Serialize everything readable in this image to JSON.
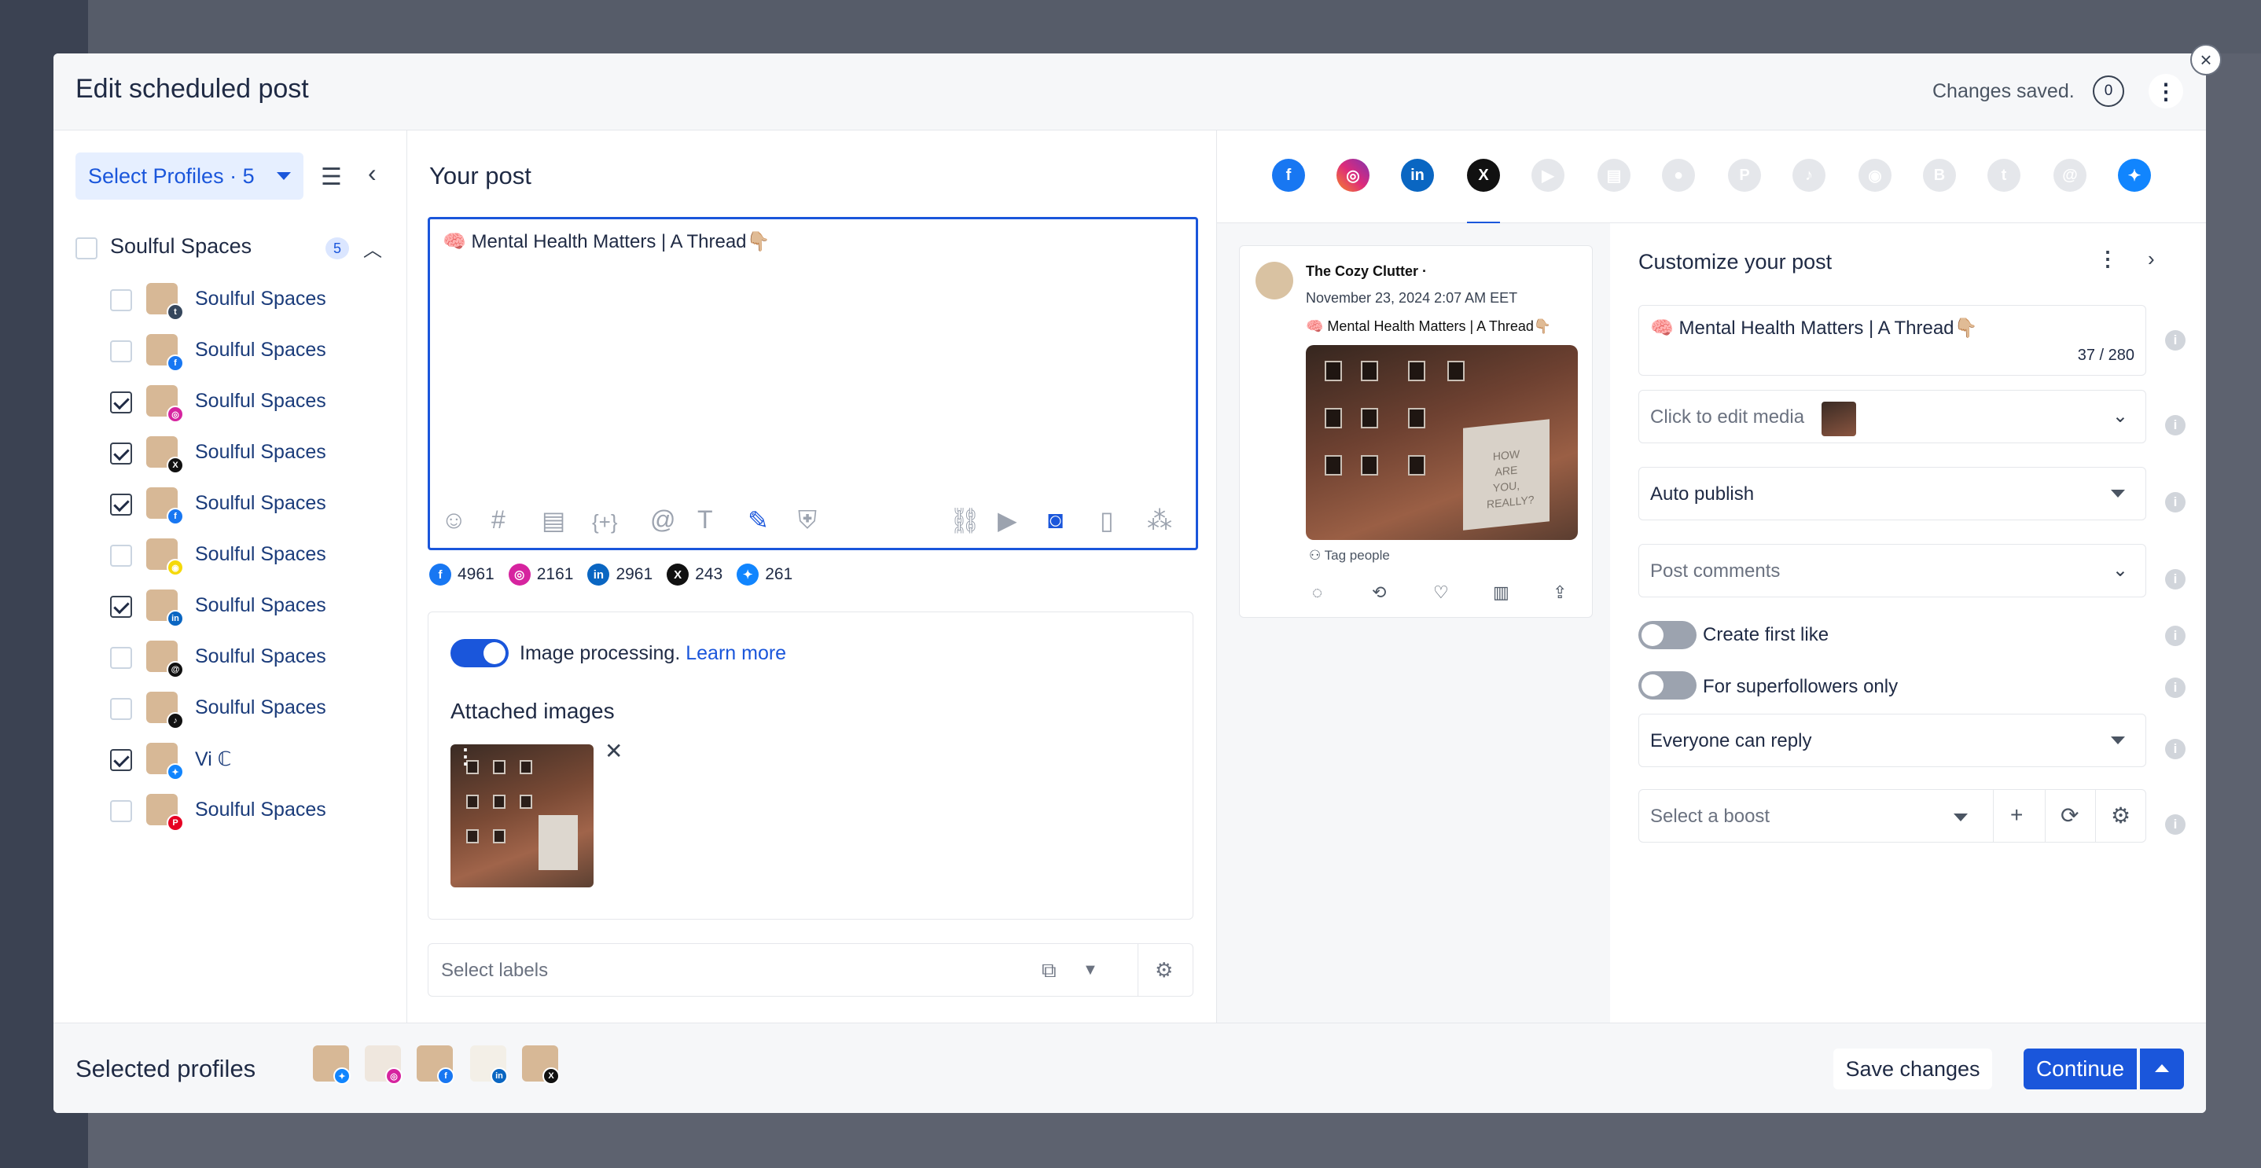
{
  "modal": {
    "title": "Edit scheduled post",
    "status": "Changes saved.",
    "comment_count": "0"
  },
  "profiles_panel": {
    "select_label": "Select Profiles · 5",
    "group_name": "Soulful Spaces",
    "group_count": "5",
    "items": [
      {
        "name": "Soulful Spaces",
        "checked": false,
        "network": "tumblr",
        "badge_color": "#35465c",
        "badge_glyph": "t"
      },
      {
        "name": "Soulful Spaces",
        "checked": false,
        "network": "facebook",
        "badge_color": "#1877f2",
        "badge_glyph": "f"
      },
      {
        "name": "Soulful Spaces",
        "checked": true,
        "network": "instagram",
        "badge_color": "#d6249f",
        "badge_glyph": "◎"
      },
      {
        "name": "Soulful Spaces",
        "checked": true,
        "network": "x",
        "badge_color": "#111111",
        "badge_glyph": "X"
      },
      {
        "name": "Soulful Spaces",
        "checked": true,
        "network": "facebook",
        "badge_color": "#1877f2",
        "badge_glyph": "f"
      },
      {
        "name": "Soulful Spaces",
        "checked": false,
        "network": "snapchat",
        "badge_color": "#f5d90a",
        "badge_glyph": "◉"
      },
      {
        "name": "Soulful Spaces",
        "checked": true,
        "network": "linkedin",
        "badge_color": "#0a66c2",
        "badge_glyph": "in"
      },
      {
        "name": "Soulful Spaces",
        "checked": false,
        "network": "threads",
        "badge_color": "#111111",
        "badge_glyph": "@"
      },
      {
        "name": "Soulful Spaces",
        "checked": false,
        "network": "tiktok",
        "badge_color": "#111111",
        "badge_glyph": "♪"
      },
      {
        "name": "Vi ℂ",
        "checked": true,
        "network": "bluesky",
        "badge_color": "#1185fe",
        "badge_glyph": "✦"
      },
      {
        "name": "Soulful Spaces",
        "checked": false,
        "network": "pinterest",
        "badge_color": "#e60023",
        "badge_glyph": "P"
      }
    ]
  },
  "post": {
    "heading": "Your post",
    "text": "🧠 Mental Health Matters | A Thread👇🏼",
    "char_counts": [
      {
        "network": "facebook",
        "value": "4961",
        "color": "#1877f2",
        "glyph": "f"
      },
      {
        "network": "instagram",
        "value": "2161",
        "color": "#d6249f",
        "glyph": "◎"
      },
      {
        "network": "linkedin",
        "value": "2961",
        "color": "#0a66c2",
        "glyph": "in"
      },
      {
        "network": "x",
        "value": "243",
        "color": "#111111",
        "glyph": "X"
      },
      {
        "network": "bluesky",
        "value": "261",
        "color": "#1185fe",
        "glyph": "✦"
      }
    ],
    "image_processing_label": "Image processing.",
    "learn_more": "Learn more",
    "attached_title": "Attached images",
    "labels_placeholder": "Select labels"
  },
  "preview": {
    "author": "The Cozy Clutter ·",
    "date": "November 23, 2024 2:07 AM EET",
    "text": "🧠 Mental Health Matters | A Thread👇🏼",
    "sign_text": "HOW ARE YOU, REALLY?",
    "tag_people": "Tag people"
  },
  "customize": {
    "title": "Customize your post",
    "post_text": "🧠 Mental Health Matters | A Thread👇🏼",
    "char_counter": "37 / 280",
    "media_label": "Click to edit media",
    "publish_mode": "Auto publish",
    "comments_placeholder": "Post comments",
    "create_first_like": "Create first like",
    "superfollowers": "For superfollowers only",
    "reply_setting": "Everyone can reply",
    "boost_placeholder": "Select a boost"
  },
  "footer": {
    "title": "Selected profiles",
    "save_label": "Save changes",
    "continue_label": "Continue"
  },
  "colors": {
    "accent": "#1a56db",
    "accent_light": "#e6efff"
  }
}
